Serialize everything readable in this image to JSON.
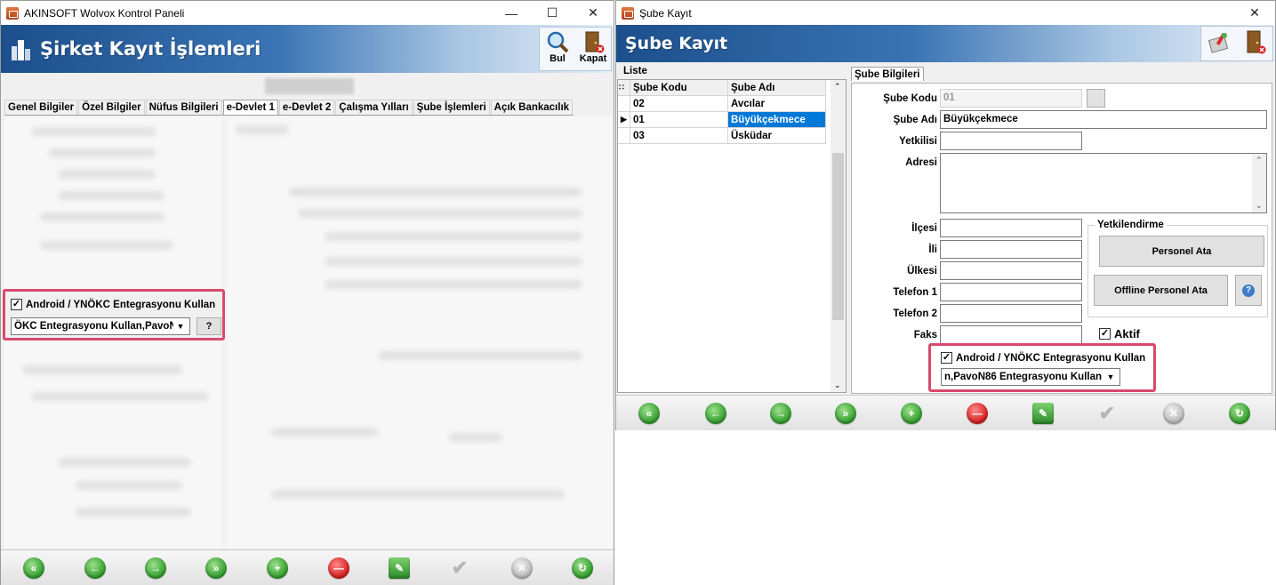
{
  "left_window": {
    "title": "AKINSOFT Wolvox Kontrol Paneli",
    "banner_title": "Şirket Kayıt İşlemleri",
    "toolbar": {
      "find_label": "Bul",
      "close_label": "Kapat"
    },
    "tabs": [
      {
        "label": "Genel Bilgiler"
      },
      {
        "label": "Özel Bilgiler"
      },
      {
        "label": "Nüfus Bilgileri"
      },
      {
        "label": "e-Devlet 1"
      },
      {
        "label": "e-Devlet 2"
      },
      {
        "label": "Çalışma Yılları"
      },
      {
        "label": "Şube İşlemleri"
      },
      {
        "label": "Açık Bankacılık"
      }
    ],
    "active_tab": "e-Devlet 1",
    "integration": {
      "checkbox_label": "Android / YNÖKC Entegrasyonu Kullan",
      "checked": true,
      "combo_value": "ÖKC Entegrasyonu Kullan,PavoN",
      "help_label": "?"
    }
  },
  "right_window": {
    "title": "Şube Kayıt",
    "banner_title": "Şube Kayıt",
    "list_label": "Liste",
    "grid": {
      "columns": [
        "Şube Kodu",
        "Şube Adı"
      ],
      "rows": [
        {
          "code": "02",
          "name": "Avcılar"
        },
        {
          "code": "01",
          "name": "Büyükçekmece"
        },
        {
          "code": "03",
          "name": "Üsküdar"
        }
      ],
      "selected_row": 1
    },
    "detail_tab": "Şube Bilgileri",
    "fields": {
      "code_label": "Şube Kodu",
      "code_value": "01",
      "name_label": "Şube Adı",
      "name_value": "Büyükçekmece",
      "authorized_label": "Yetkilisi",
      "address_label": "Adresi",
      "district_label": "İlçesi",
      "city_label": "İli",
      "country_label": "Ülkesi",
      "phone1_label": "Telefon 1",
      "phone2_label": "Telefon 2",
      "fax_label": "Faks"
    },
    "authorization": {
      "group_label": "Yetkilendirme",
      "assign_staff_label": "Personel Ata",
      "offline_assign_label": "Offline Personel Ata",
      "help_label": "?"
    },
    "active": {
      "label": "Aktif",
      "checked": true
    },
    "integration": {
      "checkbox_label": "Android / YNÖKC Entegrasyonu Kullan",
      "checked": true,
      "combo_value": "n,PavoN86 Entegrasyonu Kullan"
    }
  },
  "colors": {
    "highlight": "#d84a6c",
    "selection": "#0078d7",
    "banner_dark": "#1c4f8c"
  }
}
